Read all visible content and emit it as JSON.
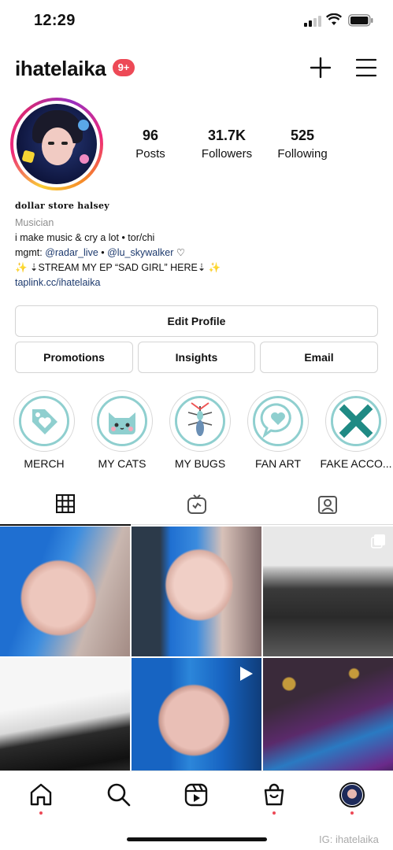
{
  "status_bar": {
    "time": "12:29"
  },
  "header": {
    "username": "ihatelaika",
    "notification_badge": "9+"
  },
  "profile": {
    "stats": [
      {
        "value": "96",
        "label": "Posts"
      },
      {
        "value": "31.7K",
        "label": "Followers"
      },
      {
        "value": "525",
        "label": "Following"
      }
    ],
    "display_name": "dollar store halsey",
    "category": "Musician",
    "bio_line1": "i make music & cry a lot • tor/chi",
    "bio_mgmt_prefix": "mgmt: ",
    "bio_handle1": "@radar_live",
    "bio_sep": " • ",
    "bio_handle2": "@lu_skywalker",
    "bio_heart": " ♡",
    "bio_line3": "✨ ⇣STREAM MY EP “SAD GIRL” HERE⇣ ✨",
    "link": "taplink.cc/ihatelaika"
  },
  "buttons": {
    "edit_profile": "Edit Profile",
    "promotions": "Promotions",
    "insights": "Insights",
    "email": "Email"
  },
  "highlights": [
    {
      "label": "MERCH",
      "icon": "tag-heart-icon"
    },
    {
      "label": "MY CATS",
      "icon": "cat-icon"
    },
    {
      "label": "MY BUGS",
      "icon": "bug-icon"
    },
    {
      "label": "FAN ART",
      "icon": "speech-heart-icon"
    },
    {
      "label": "FAKE ACCO...",
      "icon": "x-mark-icon"
    }
  ],
  "tabs": [
    {
      "icon": "grid-icon",
      "active": true
    },
    {
      "icon": "igtv-icon",
      "active": false
    },
    {
      "icon": "tagged-icon",
      "active": false
    }
  ],
  "posts": [
    {
      "type": "photo"
    },
    {
      "type": "photo"
    },
    {
      "type": "carousel"
    },
    {
      "type": "photo"
    },
    {
      "type": "video"
    },
    {
      "type": "photo"
    }
  ],
  "bottom_nav": [
    "home-icon",
    "search-icon",
    "reels-icon",
    "shop-icon",
    "profile-avatar"
  ],
  "watermark": "IG: ihatelaika",
  "colors": {
    "badge": "#ed4956",
    "link": "#1d3a6e",
    "highlight_teal": "#8fcfcf"
  }
}
